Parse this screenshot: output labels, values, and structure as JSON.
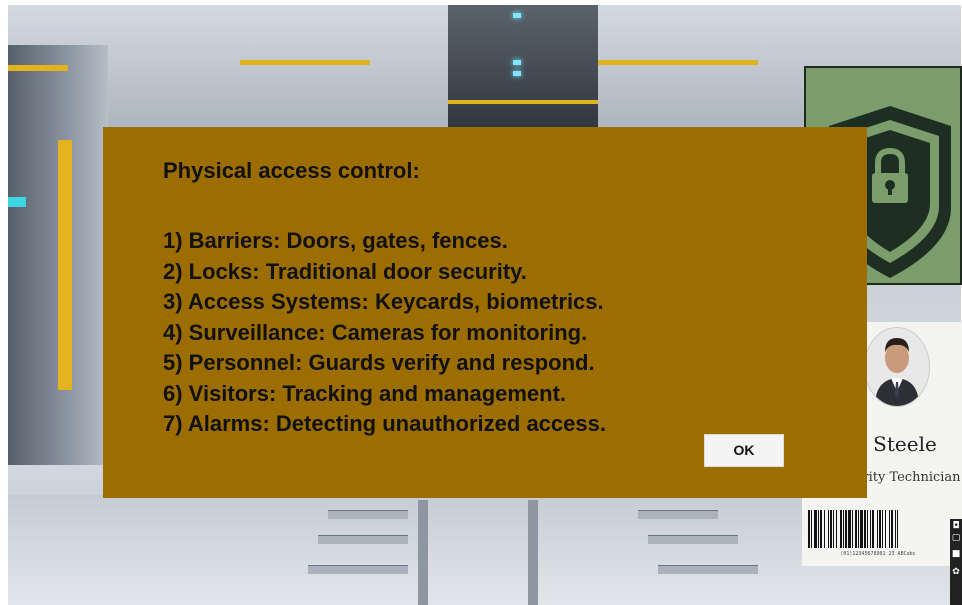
{
  "dialog": {
    "title": "Physical access control:",
    "items": [
      "1) Barriers: Doors, gates, fences.",
      "2) Locks: Traditional door security.",
      "3) Access Systems: Keycards, biometrics.",
      "4) Surveillance: Cameras for monitoring.",
      "5) Personnel: Guards verify and respond.",
      "6) Visitors: Tracking and management.",
      "7) Alarms: Detecting unauthorized access."
    ],
    "ok_label": "OK",
    "background_color": "#9c6d00"
  },
  "id_card": {
    "name": "an Steele",
    "role": "urity Technician",
    "barcode_number": "(01)12345678901 23 ABCabc"
  },
  "shield_card": {
    "icon": "shield-lock-icon",
    "background_color": "#7a9d6b"
  },
  "toolbar": {
    "icons": [
      "camera-icon",
      "card-icon",
      "chat-icon",
      "gear-icon"
    ]
  }
}
